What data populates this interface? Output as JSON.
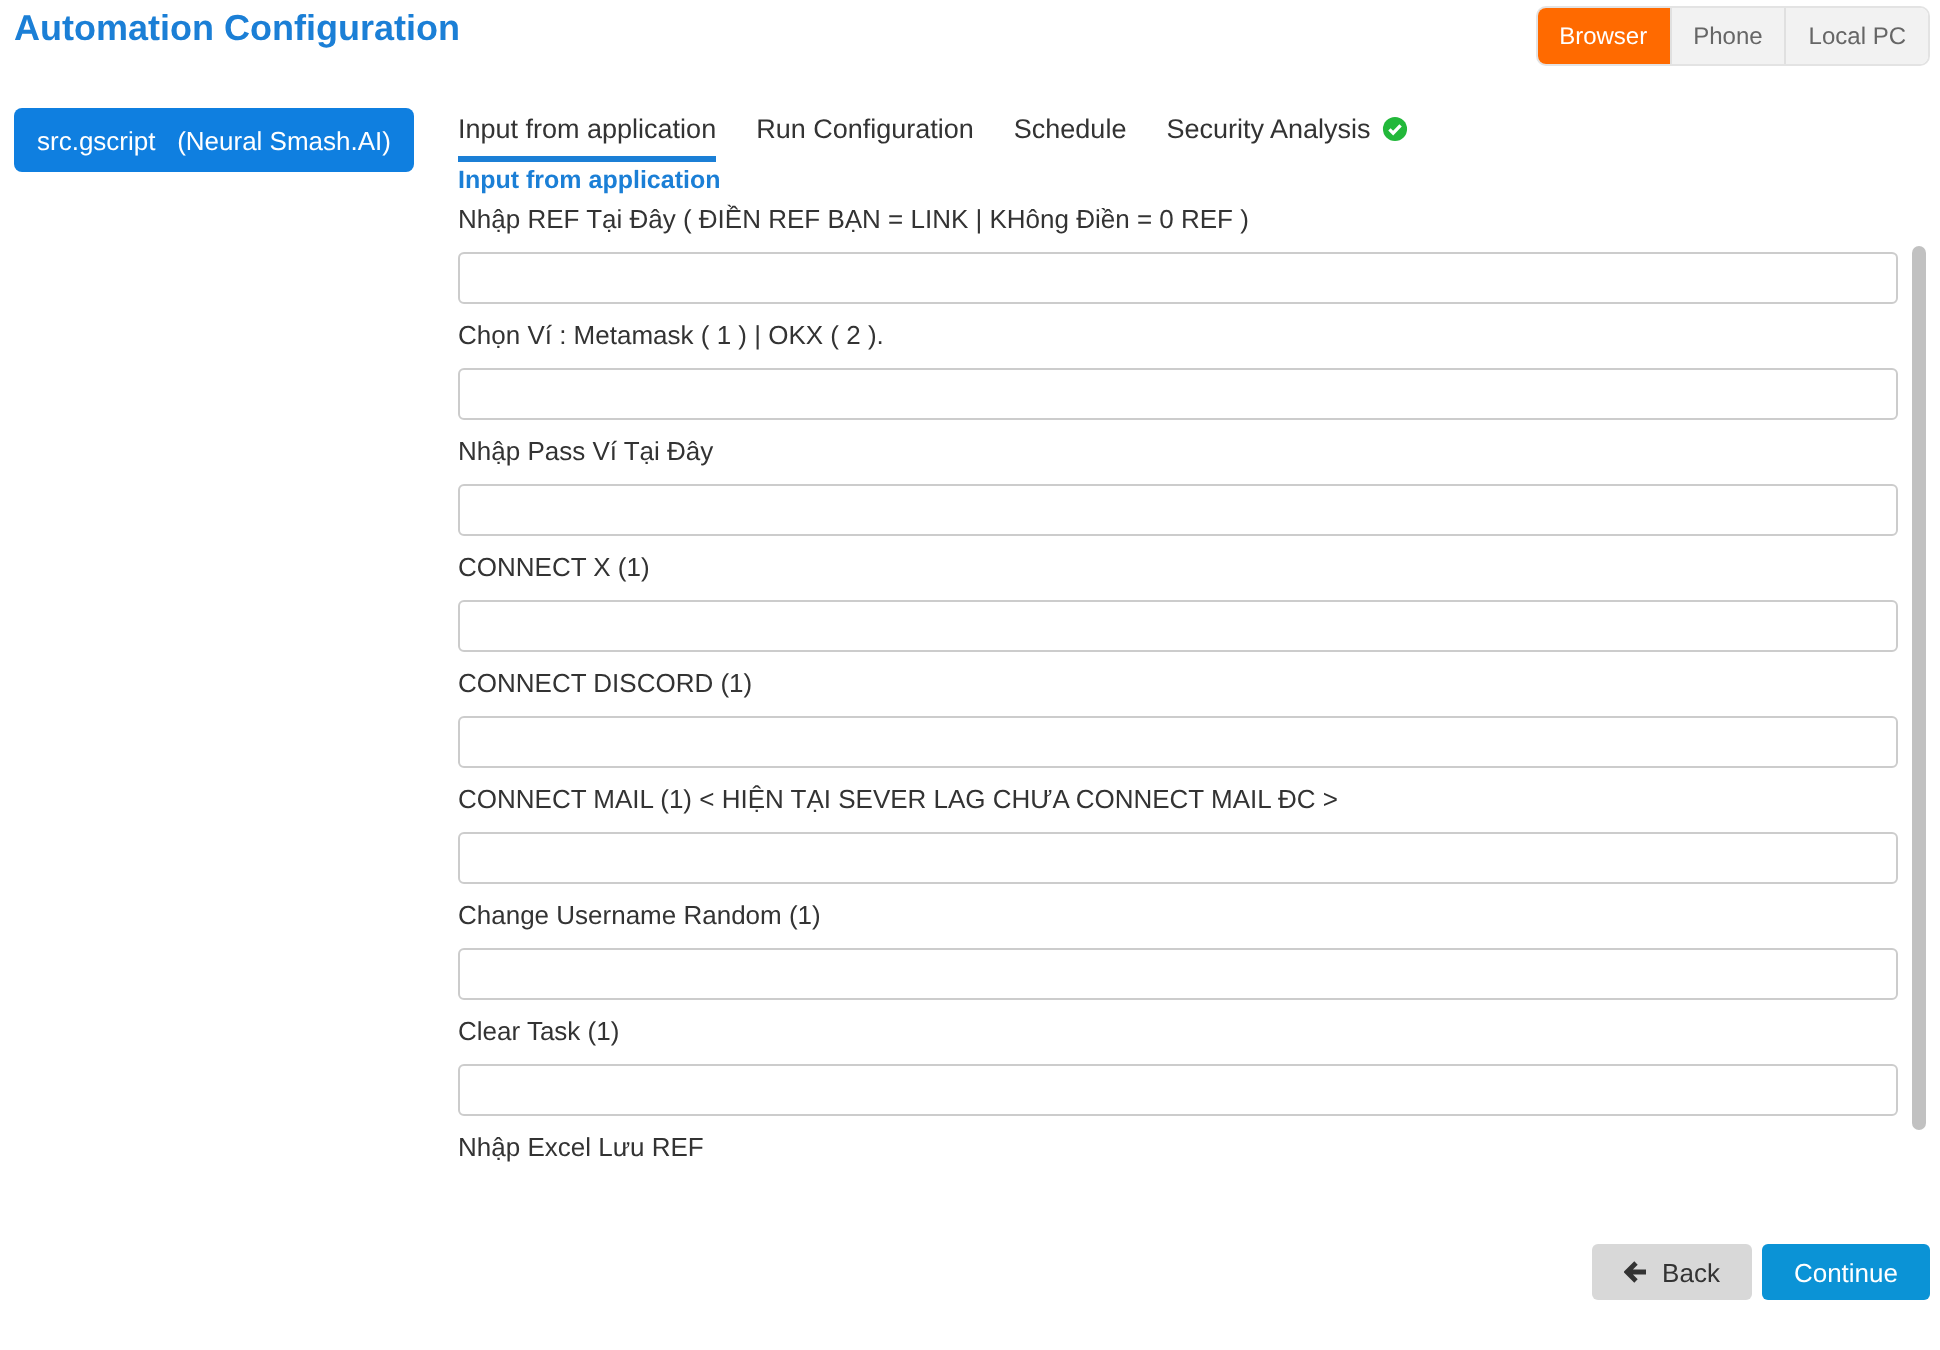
{
  "title": "Automation Configuration",
  "platforms": [
    {
      "label": "Browser",
      "selected": true
    },
    {
      "label": "Phone",
      "selected": false
    },
    {
      "label": "Local PC",
      "selected": false
    }
  ],
  "sidebar": {
    "items": [
      {
        "label": "src.gscript   (Neural Smash.AI)",
        "selected": true
      }
    ]
  },
  "tabs": [
    {
      "label": "Input from application",
      "selected": true,
      "verified": false
    },
    {
      "label": "Run Configuration",
      "selected": false,
      "verified": false
    },
    {
      "label": "Schedule",
      "selected": false,
      "verified": false
    },
    {
      "label": "Security Analysis",
      "selected": false,
      "verified": true
    }
  ],
  "section_title": "Input from application",
  "fields": [
    {
      "label": "Nhập REF Tại Đây ( ĐIỀN REF BẠN = LINK | KHông Điền = 0 REF )",
      "kind": "text"
    },
    {
      "label": "Chọn Ví : Metamask ( 1 ) | OKX ( 2 ).",
      "kind": "text"
    },
    {
      "label": "Nhập Pass Ví Tại Đây",
      "kind": "text"
    },
    {
      "label": "CONNECT X (1)",
      "kind": "text"
    },
    {
      "label": "CONNECT DISCORD (1)",
      "kind": "text"
    },
    {
      "label": "CONNECT MAIL (1) < HIỆN TẠI SEVER LAG CHƯA CONNECT MAIL ĐC  >",
      "kind": "text"
    },
    {
      "label": "Change Username Random (1)",
      "kind": "text"
    },
    {
      "label": "Clear Task (1)",
      "kind": "text"
    },
    {
      "label": "Nhập Excel Lưu REF",
      "kind": "label"
    }
  ],
  "buttons": [
    {
      "label": "Back",
      "kind": "back"
    },
    {
      "label": "Continue",
      "kind": "primary"
    }
  ]
}
